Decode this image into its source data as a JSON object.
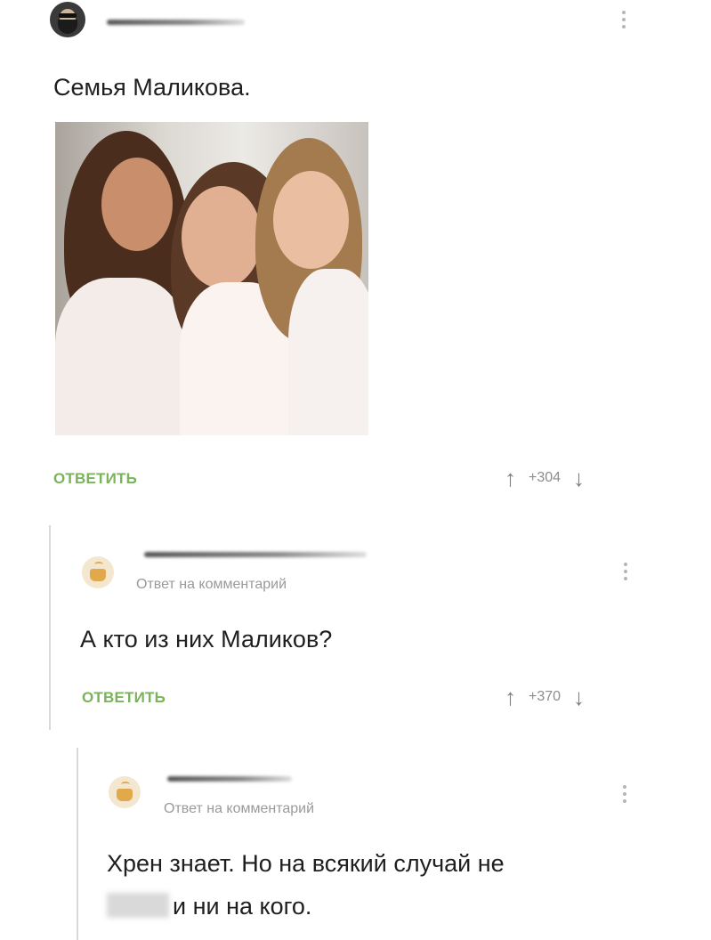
{
  "post": {
    "title": "Семья Маликова.",
    "actions": {
      "reply_label": "ОТВЕТИТЬ",
      "score": "+304"
    }
  },
  "comment1": {
    "reply_to_label": "Ответ на комментарий",
    "text": "А кто из них Маликов?",
    "actions": {
      "reply_label": "ОТВЕТИТЬ",
      "score": "+370"
    }
  },
  "comment2": {
    "reply_to_label": "Ответ на комментарий",
    "text_line1": "Хрен знает. Но на всякий случай не",
    "text_line2_visible": "и ни на кого."
  },
  "colors": {
    "accent_green": "#7ab35a",
    "muted_text": "#9a9a9a",
    "thread_line": "#d9d9d9"
  },
  "icons": {
    "upvote": "up-arrow-icon",
    "downvote": "down-arrow-icon",
    "more": "more-vertical-icon"
  }
}
